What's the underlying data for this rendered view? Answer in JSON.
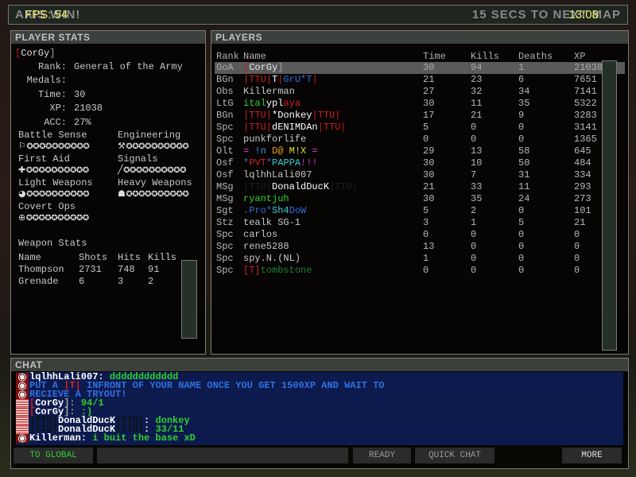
{
  "topbar": {
    "message": "AXIS WIN!",
    "next_map": "15 SECS TO NEXT MAP",
    "fps": "FPS: 54",
    "clock": "13:08"
  },
  "player_stats": {
    "title": "PLAYER STATS",
    "player_name": [
      {
        "t": "[",
        "c": "#c02020"
      },
      {
        "t": "CorGy",
        "c": "#e0e0e0"
      },
      {
        "t": "]",
        "c": "#a0a0a0"
      }
    ],
    "fields": [
      {
        "label": "Rank:",
        "value": "General of the Army"
      },
      {
        "label": "Medals:",
        "value": ""
      },
      {
        "label": "Time:",
        "value": "30"
      },
      {
        "label": "XP:",
        "value": "21038"
      },
      {
        "label": "ACC:",
        "value": "27%"
      }
    ],
    "skills": [
      {
        "name": "Battle Sense",
        "icon": "battle-sense-icon",
        "level": 0
      },
      {
        "name": "Engineering",
        "icon": "wrench-icon",
        "level": 0
      },
      {
        "name": "First Aid",
        "icon": "medic-cross-icon",
        "level": 0
      },
      {
        "name": "Signals",
        "icon": "signals-icon",
        "level": 0
      },
      {
        "name": "Light Weapons",
        "icon": "pistol-icon",
        "level": 0
      },
      {
        "name": "Heavy Weapons",
        "icon": "heavy-weapons-icon",
        "level": 0
      },
      {
        "name": "Covert Ops",
        "icon": "crosshair-icon",
        "level": 0
      }
    ],
    "weapon_stats": {
      "title": "Weapon Stats",
      "headers": [
        "Name",
        "Shots",
        "Hits",
        "Kills"
      ],
      "rows": [
        [
          "Thompson",
          "2731",
          "748",
          "91"
        ],
        [
          "Grenade",
          "6",
          "3",
          "2"
        ]
      ]
    }
  },
  "players": {
    "title": "PLAYERS",
    "headers": [
      "Rank",
      "Name",
      "Time",
      "Kills",
      "Deaths",
      "XP"
    ],
    "rows": [
      {
        "rank": "GoA",
        "name": [
          {
            "t": "[",
            "c": "#c02020"
          },
          {
            "t": "CorGy",
            "c": "#e8e8e8"
          },
          {
            "t": "]",
            "c": "#a0a0a0"
          }
        ],
        "time": "30",
        "kills": "94",
        "deaths": "1",
        "xp": "21038",
        "selected": true
      },
      {
        "rank": "BGn",
        "name": [
          {
            "t": "|TTU|",
            "c": "#d02020"
          },
          {
            "t": "T",
            "c": "#ffffff"
          },
          {
            "t": "|",
            "c": "#d02020"
          },
          {
            "t": "GrU*T",
            "c": "#3070e0"
          },
          {
            "t": "|",
            "c": "#d02020"
          }
        ],
        "time": "21",
        "kills": "23",
        "deaths": "6",
        "xp": "7651"
      },
      {
        "rank": "Obs",
        "name": [
          {
            "t": "Killerman",
            "c": "#c8c8c8"
          }
        ],
        "time": "27",
        "kills": "32",
        "deaths": "34",
        "xp": "7141"
      },
      {
        "rank": "LtG",
        "name": [
          {
            "t": "ital",
            "c": "#30d030"
          },
          {
            "t": "ypl",
            "c": "#ffffff"
          },
          {
            "t": "aya",
            "c": "#d02020"
          }
        ],
        "time": "30",
        "kills": "11",
        "deaths": "35",
        "xp": "5322"
      },
      {
        "rank": "BGn",
        "name": [
          {
            "t": "|TTU|",
            "c": "#d02020"
          },
          {
            "t": "*Donkey",
            "c": "#ffffff"
          },
          {
            "t": "|TTU|",
            "c": "#d02020"
          }
        ],
        "time": "17",
        "kills": "21",
        "deaths": "9",
        "xp": "3283"
      },
      {
        "rank": "Spc",
        "name": [
          {
            "t": "|TTU|",
            "c": "#d02020"
          },
          {
            "t": "dENIMDAn",
            "c": "#ffffff"
          },
          {
            "t": "|TTU|",
            "c": "#d02020"
          }
        ],
        "time": "5",
        "kills": "0",
        "deaths": "0",
        "xp": "3141"
      },
      {
        "rank": "Spc",
        "name": [
          {
            "t": "punkforlife",
            "c": "#c8c8c8"
          }
        ],
        "time": "0",
        "kills": "0",
        "deaths": "0",
        "xp": "1365"
      },
      {
        "rank": "Olt",
        "name": [
          {
            "t": "= ",
            "c": "#d040d0"
          },
          {
            "t": "!n ",
            "c": "#30a0e0"
          },
          {
            "t": "D@ ",
            "c": "#e0a020"
          },
          {
            "t": "M!X",
            "c": "#e0e030"
          },
          {
            "t": " =",
            "c": "#d040d0"
          }
        ],
        "time": "29",
        "kills": "13",
        "deaths": "58",
        "xp": "645"
      },
      {
        "rank": "Osf",
        "name": [
          {
            "t": "*",
            "c": "#3070e0"
          },
          {
            "t": "PVT",
            "c": "#d02020"
          },
          {
            "t": "*",
            "c": "#3070e0"
          },
          {
            "t": "PAPPA",
            "c": "#30d0d0"
          },
          {
            "t": "!!!",
            "c": "#b040d0"
          }
        ],
        "time": "30",
        "kills": "10",
        "deaths": "50",
        "xp": "484"
      },
      {
        "rank": "Osf",
        "name": [
          {
            "t": "lqlhhLali007",
            "c": "#c8c8c8"
          }
        ],
        "time": "30",
        "kills": "7",
        "deaths": "31",
        "xp": "334"
      },
      {
        "rank": "MSg",
        "name": [
          {
            "t": "|TTU|",
            "c": "#202020"
          },
          {
            "t": "DonaldDucK",
            "c": "#ffffff"
          },
          {
            "t": "|TTU|",
            "c": "#202020"
          }
        ],
        "time": "21",
        "kills": "33",
        "deaths": "11",
        "xp": "293"
      },
      {
        "rank": "MSg",
        "name": [
          {
            "t": "ryantjuh",
            "c": "#30d030"
          }
        ],
        "time": "30",
        "kills": "35",
        "deaths": "24",
        "xp": "273"
      },
      {
        "rank": "Sgt",
        "name": [
          {
            "t": ".Pro*",
            "c": "#3070e0"
          },
          {
            "t": "Sh4",
            "c": "#30d0d0"
          },
          {
            "t": "DoW",
            "c": "#3070e0"
          }
        ],
        "time": "5",
        "kills": "2",
        "deaths": "0",
        "xp": "101"
      },
      {
        "rank": "Stz",
        "name": [
          {
            "t": "tealk SG-1",
            "c": "#c8c8c8"
          }
        ],
        "time": "3",
        "kills": "1",
        "deaths": "5",
        "xp": "21"
      },
      {
        "rank": "Spc",
        "name": [
          {
            "t": "carlos",
            "c": "#c8c8c8"
          }
        ],
        "time": "0",
        "kills": "0",
        "deaths": "0",
        "xp": "0"
      },
      {
        "rank": "Spc",
        "name": [
          {
            "t": "rene5288",
            "c": "#c8c8c8"
          }
        ],
        "time": "13",
        "kills": "0",
        "deaths": "0",
        "xp": "0"
      },
      {
        "rank": "Spc",
        "name": [
          {
            "t": "spy.N.(NL)",
            "c": "#c8c8c8"
          }
        ],
        "time": "1",
        "kills": "0",
        "deaths": "0",
        "xp": "0"
      },
      {
        "rank": "Spc",
        "name": [
          {
            "t": "[T]",
            "c": "#d02020"
          },
          {
            "t": "tombstone",
            "c": "#208030"
          }
        ],
        "time": "0",
        "kills": "0",
        "deaths": "0",
        "xp": "0"
      }
    ]
  },
  "chat": {
    "title": "CHAT",
    "lines": [
      {
        "team": "axis",
        "seg": [
          {
            "t": "lqlhhLali007: ",
            "c": "#ffffff"
          },
          {
            "t": "dddddddddddd",
            "c": "#30d030"
          }
        ]
      },
      {
        "team": "axis",
        "seg": [
          {
            "t": "PUT A ",
            "c": "#3070e0"
          },
          {
            "t": "|",
            "c": "#d02020"
          },
          {
            "t": "T",
            "c": "#d02020"
          },
          {
            "t": "|",
            "c": "#d02020"
          },
          {
            "t": " INFRONT OF YOUR NAME ONCE YOU GET 1500XP AND WAIT TO",
            "c": "#3070e0"
          }
        ]
      },
      {
        "team": "axis",
        "seg": [
          {
            "t": "RECIEVE A TRYOUT!",
            "c": "#3070e0"
          }
        ]
      },
      {
        "team": "allies",
        "seg": [
          {
            "t": "[",
            "c": "#c02020"
          },
          {
            "t": "CorGy",
            "c": "#ffffff"
          },
          {
            "t": "]: ",
            "c": "#a0a0a0"
          },
          {
            "t": "94/1",
            "c": "#30d030"
          }
        ]
      },
      {
        "team": "allies",
        "seg": [
          {
            "t": "[",
            "c": "#c02020"
          },
          {
            "t": "CorGy",
            "c": "#ffffff"
          },
          {
            "t": "]: ",
            "c": "#a0a0a0"
          },
          {
            "t": ":)",
            "c": "#30d030"
          }
        ]
      },
      {
        "team": "allies",
        "seg": [
          {
            "t": "|TTU|",
            "c": "#101010"
          },
          {
            "t": "DonaldDucK",
            "c": "#ffffff"
          },
          {
            "t": "|TTU|",
            "c": "#101010"
          },
          {
            "t": ": ",
            "c": "#ffffff"
          },
          {
            "t": "donkey",
            "c": "#30d030"
          }
        ]
      },
      {
        "team": "allies",
        "seg": [
          {
            "t": "|TTU|",
            "c": "#101010"
          },
          {
            "t": "DonaldDucK",
            "c": "#ffffff"
          },
          {
            "t": "|TTU|",
            "c": "#101010"
          },
          {
            "t": ": ",
            "c": "#ffffff"
          },
          {
            "t": "33/11",
            "c": "#30d030"
          }
        ]
      },
      {
        "team": "axis",
        "seg": [
          {
            "t": "Killerman: ",
            "c": "#ffffff"
          },
          {
            "t": "i buit the base xD",
            "c": "#30d030"
          }
        ]
      }
    ],
    "to_global": "TO GLOBAL",
    "input_value": "",
    "ready": "READY",
    "quick_chat": "QUICK CHAT",
    "more": "MORE"
  }
}
